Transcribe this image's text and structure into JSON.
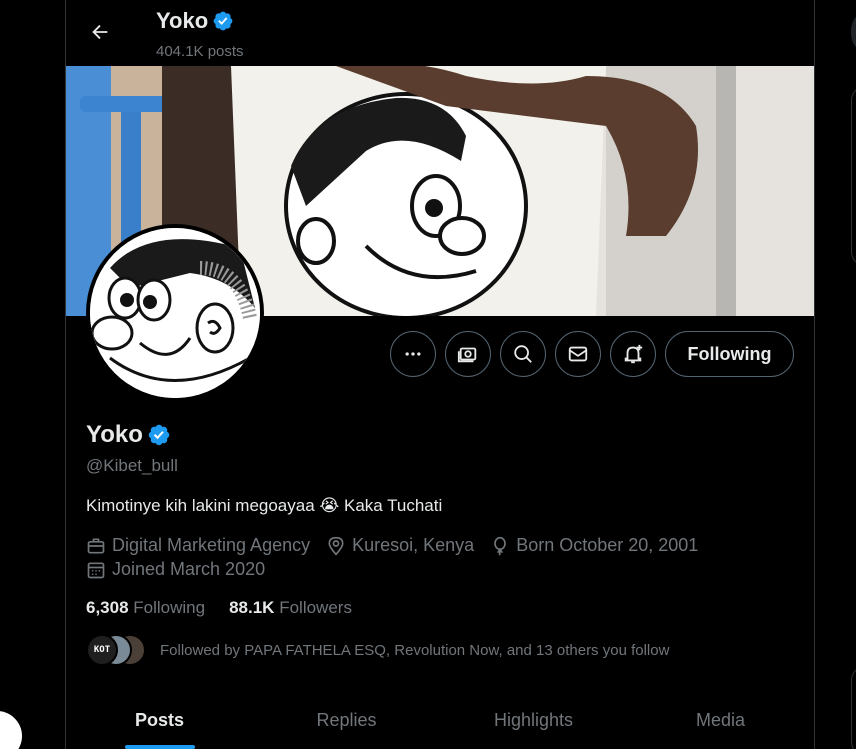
{
  "header": {
    "name": "Yoko",
    "posts": "404.1K posts"
  },
  "actions": {
    "follow_label": "Following"
  },
  "profile": {
    "name": "Yoko",
    "handle": "@Kibet_bull",
    "bio": "Kimotinye kih lakini megoayaa 😭 Kaka Tuchati",
    "category": "Digital Marketing Agency",
    "location": "Kuresoi, Kenya",
    "birthday": "Born October 20, 2001",
    "joined": "Joined March 2020"
  },
  "stats": {
    "following_count": "6,308",
    "following_label": "Following",
    "followers_count": "88.1K",
    "followers_label": "Followers"
  },
  "followed_by": {
    "text": "Followed by PAPA FATHELA ESQ, Revolution Now, and 13 others you follow",
    "avatar_text": "KOT"
  },
  "tabs": [
    {
      "label": "Posts",
      "active": true
    },
    {
      "label": "Replies",
      "active": false
    },
    {
      "label": "Highlights",
      "active": false
    },
    {
      "label": "Media",
      "active": false
    }
  ],
  "colors": {
    "accent": "#1d9bf0",
    "muted": "#71767b",
    "text": "#e7e9ea",
    "background": "#000000"
  }
}
